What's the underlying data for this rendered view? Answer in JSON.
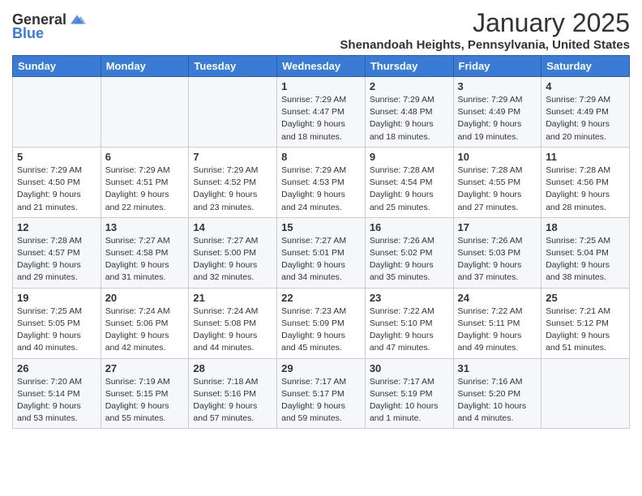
{
  "logo": {
    "line1": "General",
    "line2": "Blue"
  },
  "title": "January 2025",
  "location": "Shenandoah Heights, Pennsylvania, United States",
  "days_of_week": [
    "Sunday",
    "Monday",
    "Tuesday",
    "Wednesday",
    "Thursday",
    "Friday",
    "Saturday"
  ],
  "weeks": [
    [
      {
        "day": "",
        "info": ""
      },
      {
        "day": "",
        "info": ""
      },
      {
        "day": "",
        "info": ""
      },
      {
        "day": "1",
        "info": "Sunrise: 7:29 AM\nSunset: 4:47 PM\nDaylight: 9 hours\nand 18 minutes."
      },
      {
        "day": "2",
        "info": "Sunrise: 7:29 AM\nSunset: 4:48 PM\nDaylight: 9 hours\nand 18 minutes."
      },
      {
        "day": "3",
        "info": "Sunrise: 7:29 AM\nSunset: 4:49 PM\nDaylight: 9 hours\nand 19 minutes."
      },
      {
        "day": "4",
        "info": "Sunrise: 7:29 AM\nSunset: 4:49 PM\nDaylight: 9 hours\nand 20 minutes."
      }
    ],
    [
      {
        "day": "5",
        "info": "Sunrise: 7:29 AM\nSunset: 4:50 PM\nDaylight: 9 hours\nand 21 minutes."
      },
      {
        "day": "6",
        "info": "Sunrise: 7:29 AM\nSunset: 4:51 PM\nDaylight: 9 hours\nand 22 minutes."
      },
      {
        "day": "7",
        "info": "Sunrise: 7:29 AM\nSunset: 4:52 PM\nDaylight: 9 hours\nand 23 minutes."
      },
      {
        "day": "8",
        "info": "Sunrise: 7:29 AM\nSunset: 4:53 PM\nDaylight: 9 hours\nand 24 minutes."
      },
      {
        "day": "9",
        "info": "Sunrise: 7:28 AM\nSunset: 4:54 PM\nDaylight: 9 hours\nand 25 minutes."
      },
      {
        "day": "10",
        "info": "Sunrise: 7:28 AM\nSunset: 4:55 PM\nDaylight: 9 hours\nand 27 minutes."
      },
      {
        "day": "11",
        "info": "Sunrise: 7:28 AM\nSunset: 4:56 PM\nDaylight: 9 hours\nand 28 minutes."
      }
    ],
    [
      {
        "day": "12",
        "info": "Sunrise: 7:28 AM\nSunset: 4:57 PM\nDaylight: 9 hours\nand 29 minutes."
      },
      {
        "day": "13",
        "info": "Sunrise: 7:27 AM\nSunset: 4:58 PM\nDaylight: 9 hours\nand 31 minutes."
      },
      {
        "day": "14",
        "info": "Sunrise: 7:27 AM\nSunset: 5:00 PM\nDaylight: 9 hours\nand 32 minutes."
      },
      {
        "day": "15",
        "info": "Sunrise: 7:27 AM\nSunset: 5:01 PM\nDaylight: 9 hours\nand 34 minutes."
      },
      {
        "day": "16",
        "info": "Sunrise: 7:26 AM\nSunset: 5:02 PM\nDaylight: 9 hours\nand 35 minutes."
      },
      {
        "day": "17",
        "info": "Sunrise: 7:26 AM\nSunset: 5:03 PM\nDaylight: 9 hours\nand 37 minutes."
      },
      {
        "day": "18",
        "info": "Sunrise: 7:25 AM\nSunset: 5:04 PM\nDaylight: 9 hours\nand 38 minutes."
      }
    ],
    [
      {
        "day": "19",
        "info": "Sunrise: 7:25 AM\nSunset: 5:05 PM\nDaylight: 9 hours\nand 40 minutes."
      },
      {
        "day": "20",
        "info": "Sunrise: 7:24 AM\nSunset: 5:06 PM\nDaylight: 9 hours\nand 42 minutes."
      },
      {
        "day": "21",
        "info": "Sunrise: 7:24 AM\nSunset: 5:08 PM\nDaylight: 9 hours\nand 44 minutes."
      },
      {
        "day": "22",
        "info": "Sunrise: 7:23 AM\nSunset: 5:09 PM\nDaylight: 9 hours\nand 45 minutes."
      },
      {
        "day": "23",
        "info": "Sunrise: 7:22 AM\nSunset: 5:10 PM\nDaylight: 9 hours\nand 47 minutes."
      },
      {
        "day": "24",
        "info": "Sunrise: 7:22 AM\nSunset: 5:11 PM\nDaylight: 9 hours\nand 49 minutes."
      },
      {
        "day": "25",
        "info": "Sunrise: 7:21 AM\nSunset: 5:12 PM\nDaylight: 9 hours\nand 51 minutes."
      }
    ],
    [
      {
        "day": "26",
        "info": "Sunrise: 7:20 AM\nSunset: 5:14 PM\nDaylight: 9 hours\nand 53 minutes."
      },
      {
        "day": "27",
        "info": "Sunrise: 7:19 AM\nSunset: 5:15 PM\nDaylight: 9 hours\nand 55 minutes."
      },
      {
        "day": "28",
        "info": "Sunrise: 7:18 AM\nSunset: 5:16 PM\nDaylight: 9 hours\nand 57 minutes."
      },
      {
        "day": "29",
        "info": "Sunrise: 7:17 AM\nSunset: 5:17 PM\nDaylight: 9 hours\nand 59 minutes."
      },
      {
        "day": "30",
        "info": "Sunrise: 7:17 AM\nSunset: 5:19 PM\nDaylight: 10 hours\nand 1 minute."
      },
      {
        "day": "31",
        "info": "Sunrise: 7:16 AM\nSunset: 5:20 PM\nDaylight: 10 hours\nand 4 minutes."
      },
      {
        "day": "",
        "info": ""
      }
    ]
  ]
}
